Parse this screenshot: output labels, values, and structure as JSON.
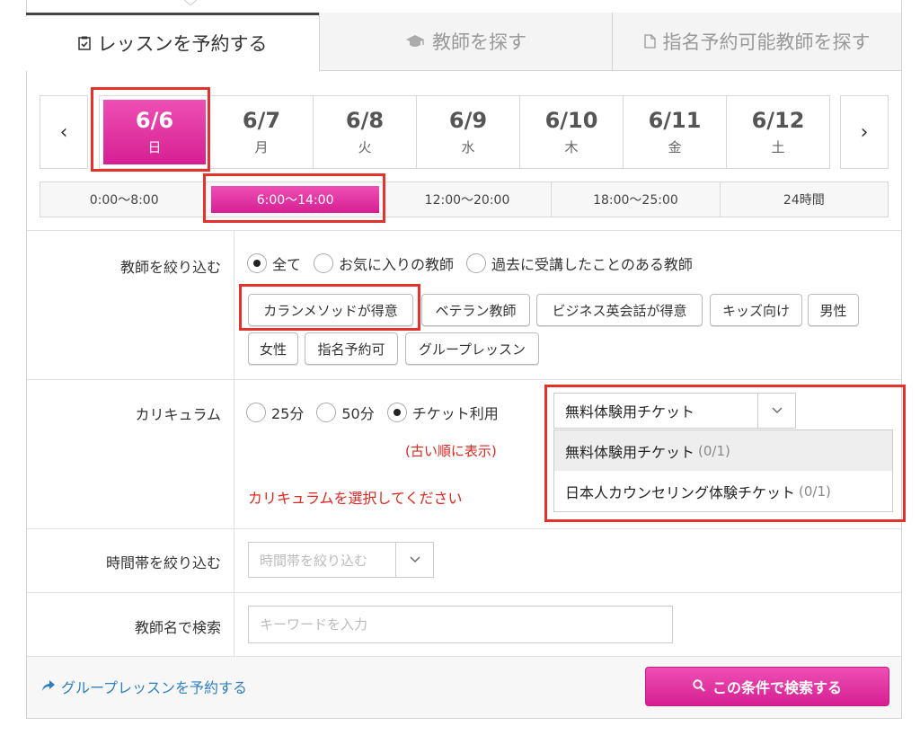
{
  "tabs": [
    {
      "label": "レッスンを予約する",
      "icon": "clipboard-check-icon"
    },
    {
      "label": "教師を探す",
      "icon": "graduation-cap-icon"
    },
    {
      "label": "指名予約可能教師を探す",
      "icon": "document-icon"
    }
  ],
  "dates": {
    "prev": "‹",
    "next": "›",
    "items": [
      {
        "date": "6/6",
        "day": "日"
      },
      {
        "date": "6/7",
        "day": "月"
      },
      {
        "date": "6/8",
        "day": "火"
      },
      {
        "date": "6/9",
        "day": "水"
      },
      {
        "date": "6/10",
        "day": "木"
      },
      {
        "date": "6/11",
        "day": "金"
      },
      {
        "date": "6/12",
        "day": "土"
      }
    ],
    "selected_index": 0
  },
  "time_ranges": [
    "0:00〜8:00",
    "6:00〜14:00",
    "12:00〜20:00",
    "18:00〜25:00",
    "24時間"
  ],
  "time_selected_index": 1,
  "teacher_filter": {
    "label": "教師を絞り込む",
    "options": [
      "全て",
      "お気に入りの教師",
      "過去に受講したことのある教師"
    ],
    "selected": "全て",
    "tags": [
      "カランメソッドが得意",
      "ベテラン教師",
      "ビジネス英会話が得意",
      "キッズ向け",
      "男性",
      "女性",
      "指名予約可",
      "グループレッスン"
    ]
  },
  "curriculum": {
    "label": "カリキュラム",
    "options": [
      "25分",
      "50分",
      "チケット利用"
    ],
    "selected": "チケット利用",
    "select_value": "無料体験用チケット",
    "sort_note": "(古い順に表示)",
    "error": "カリキュラムを選択してください",
    "dropdown": [
      {
        "name": "無料体験用チケット",
        "count": "(0/1)"
      },
      {
        "name": "日本人カウンセリング体験チケット",
        "count": "(0/1)"
      }
    ]
  },
  "time_filter": {
    "label": "時間帯を絞り込む",
    "placeholder": "時間帯を絞り込む"
  },
  "teacher_search": {
    "label": "教師名で検索",
    "placeholder": "キーワードを入力"
  },
  "footer": {
    "group_link": "グループレッスンを予約する",
    "search_button": "この条件で検索する"
  },
  "colors": {
    "accent": "#d61f93",
    "highlight": "#e3322b",
    "error": "#e0261f",
    "link": "#2e7fc1"
  }
}
